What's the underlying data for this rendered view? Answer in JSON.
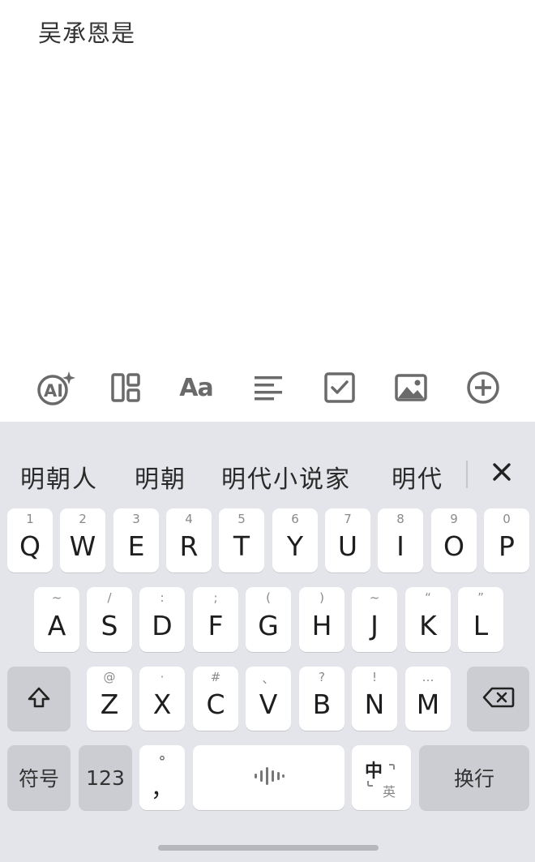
{
  "editor": {
    "text": "吴承恩是"
  },
  "toolbar": {
    "items": [
      {
        "icon": "ai-icon",
        "label": "AI"
      },
      {
        "icon": "layout-icon"
      },
      {
        "icon": "font-size-icon",
        "label": "Aa"
      },
      {
        "icon": "align-left-icon"
      },
      {
        "icon": "checkbox-icon"
      },
      {
        "icon": "image-icon"
      },
      {
        "icon": "add-circle-icon"
      }
    ]
  },
  "keyboard": {
    "candidates": [
      "明朝人",
      "明朝",
      "明代小说家",
      "明代"
    ],
    "close_icon": "close-icon",
    "row1": [
      {
        "letter": "Q",
        "hint": "1"
      },
      {
        "letter": "W",
        "hint": "2"
      },
      {
        "letter": "E",
        "hint": "3"
      },
      {
        "letter": "R",
        "hint": "4"
      },
      {
        "letter": "T",
        "hint": "5"
      },
      {
        "letter": "Y",
        "hint": "6"
      },
      {
        "letter": "U",
        "hint": "7"
      },
      {
        "letter": "I",
        "hint": "8"
      },
      {
        "letter": "O",
        "hint": "9"
      },
      {
        "letter": "P",
        "hint": "0"
      }
    ],
    "row2": [
      {
        "letter": "A",
        "hint": "~"
      },
      {
        "letter": "S",
        "hint": "/"
      },
      {
        "letter": "D",
        "hint": ":"
      },
      {
        "letter": "F",
        "hint": ";"
      },
      {
        "letter": "G",
        "hint": "("
      },
      {
        "letter": "H",
        "hint": ")"
      },
      {
        "letter": "J",
        "hint": "~"
      },
      {
        "letter": "K",
        "hint": "“"
      },
      {
        "letter": "L",
        "hint": "”"
      }
    ],
    "row3": [
      {
        "letter": "Z",
        "hint": "@"
      },
      {
        "letter": "X",
        "hint": "·"
      },
      {
        "letter": "C",
        "hint": "#"
      },
      {
        "letter": "V",
        "hint": "、"
      },
      {
        "letter": "B",
        "hint": "?"
      },
      {
        "letter": "N",
        "hint": "!"
      },
      {
        "letter": "M",
        "hint": "…"
      }
    ],
    "shift_icon": "shift-icon",
    "backspace_icon": "backspace-icon",
    "symbols_label": "符号",
    "numbers_label": "123",
    "punct_top": "°",
    "punct_main": "，",
    "space_icon": "voice-waveform-icon",
    "lang_primary": "中",
    "lang_secondary": "英",
    "enter_label": "换行"
  }
}
